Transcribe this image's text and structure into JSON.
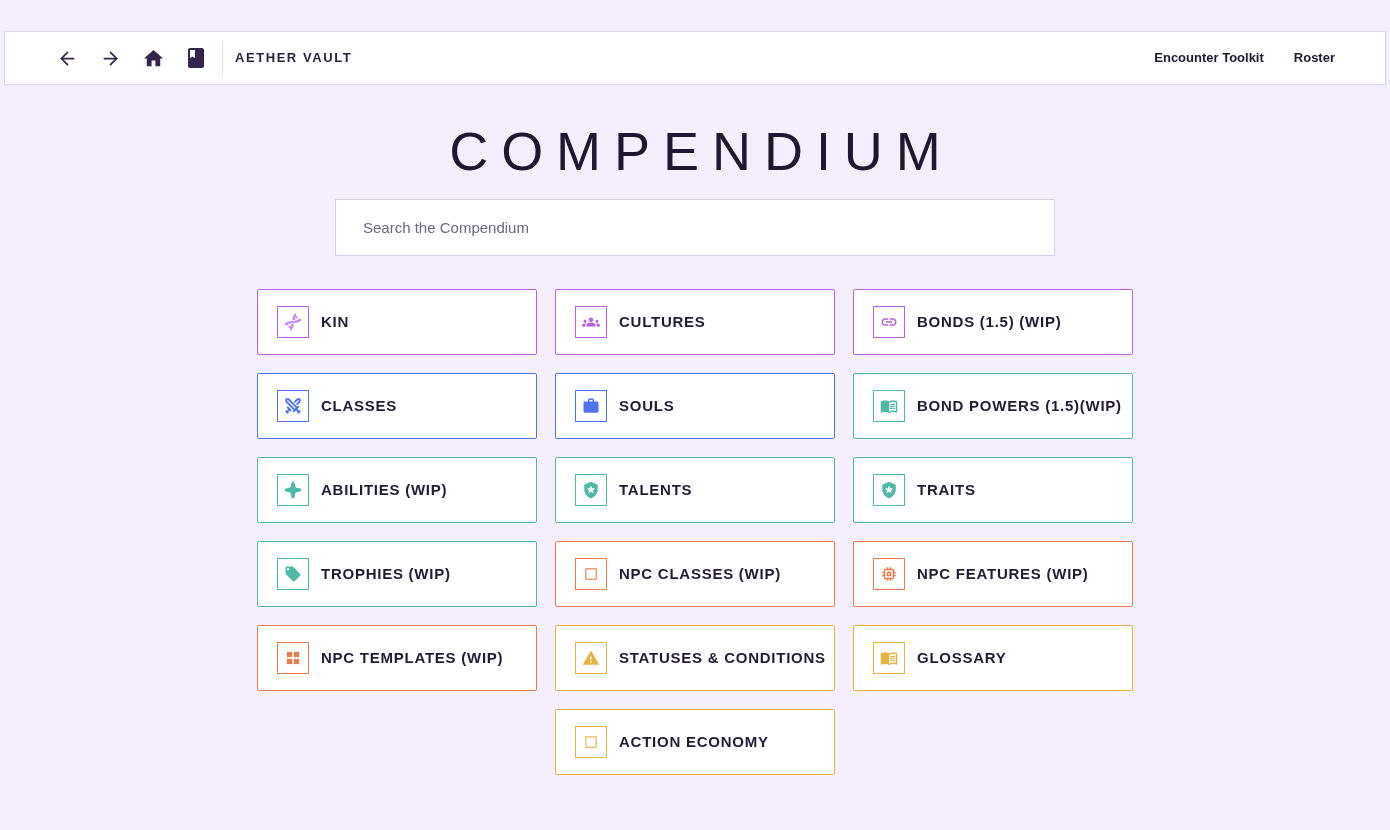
{
  "top_bar": {
    "brand": "AETHER VAULT",
    "links": [
      "Encounter Toolkit",
      "Roster"
    ]
  },
  "title": "COMPENDIUM",
  "search": {
    "placeholder": "Search the Compendium"
  },
  "cards": [
    {
      "label": "KIN",
      "color": "#b75ee8"
    },
    {
      "label": "CULTURES",
      "color": "#b75ee8"
    },
    {
      "label": "BONDS (1.5) (WIP)",
      "color": "#b75ee8"
    },
    {
      "label": "CLASSES",
      "color": "#4d73ef"
    },
    {
      "label": "SOULS",
      "color": "#4d73ef"
    },
    {
      "label": "BOND POWERS (1.5)(WIP)",
      "color": "#4fb9a9"
    },
    {
      "label": "ABILITIES (WIP)",
      "color": "#4fb9a9"
    },
    {
      "label": "TALENTS",
      "color": "#4fb9a9"
    },
    {
      "label": "TRAITS",
      "color": "#4fb9a9"
    },
    {
      "label": "TROPHIES (WIP)",
      "color": "#4fb9a9"
    },
    {
      "label": "NPC CLASSES (WIP)",
      "color": "#ee7b4c"
    },
    {
      "label": "NPC FEATURES (WIP)",
      "color": "#ee7b4c"
    },
    {
      "label": "NPC TEMPLATES (WIP)",
      "color": "#ee7b4c"
    },
    {
      "label": "STATUSES & CONDITIONS",
      "color": "#e8b23e"
    },
    {
      "label": "GLOSSARY",
      "color": "#e8b23e"
    },
    {
      "label": "ACTION ECONOMY",
      "color": "#e8b23e"
    }
  ]
}
